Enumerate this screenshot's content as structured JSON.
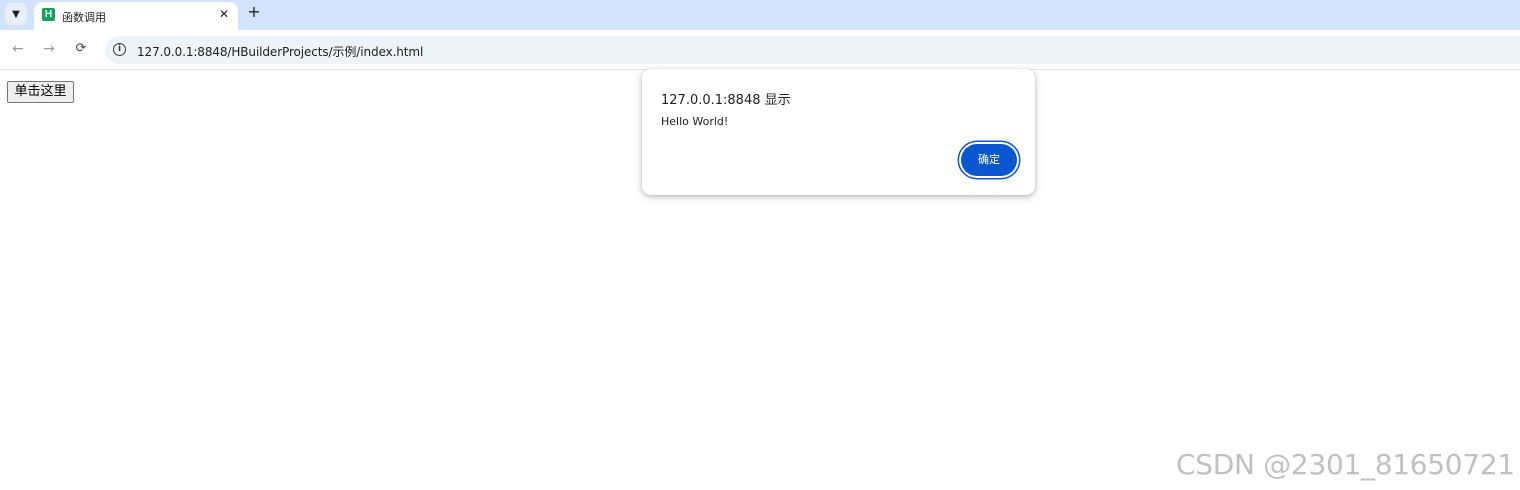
{
  "browser": {
    "tab_search_icon": "chevron-down-icon",
    "tab": {
      "favicon_icon": "hbuilder-logo-icon",
      "favicon_text": "H",
      "favicon_color": "#17a25b",
      "title": "函数调用",
      "close_glyph": "✕"
    },
    "new_tab_glyph": "+",
    "nav": {
      "back_glyph": "←",
      "forward_glyph": "→",
      "reload_glyph": "⟳"
    },
    "address": {
      "info_glyph": "i",
      "url": "127.0.0.1:8848/HBuilderProjects/示例/index.html"
    }
  },
  "page": {
    "button_label": "单击这里"
  },
  "alert": {
    "title": "127.0.0.1:8848 显示",
    "message": "Hello World!",
    "ok_label": "确定",
    "ok_color": "#0b57d0"
  },
  "watermark": {
    "text": "CSDN @2301_81650721"
  }
}
